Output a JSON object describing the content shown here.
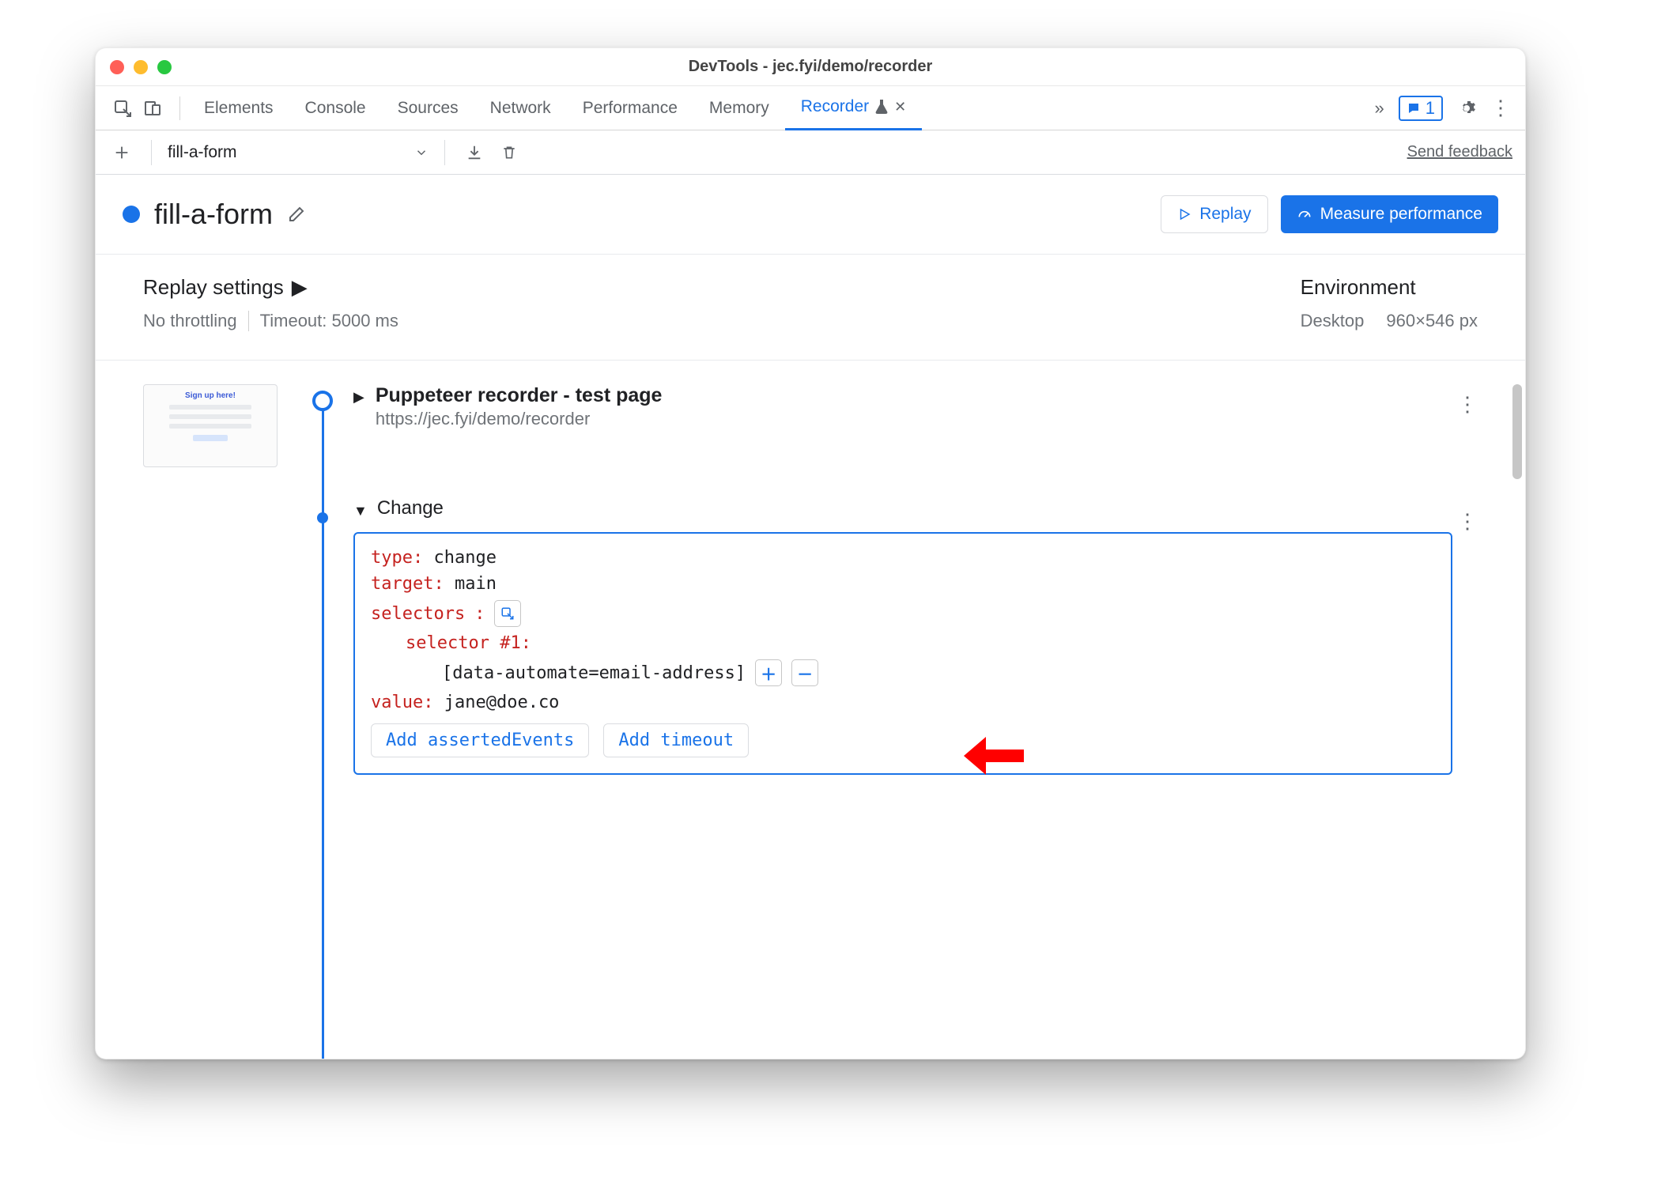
{
  "window": {
    "title": "DevTools - jec.fyi/demo/recorder"
  },
  "tabs": {
    "items": [
      "Elements",
      "Console",
      "Sources",
      "Network",
      "Performance",
      "Memory",
      "Recorder"
    ],
    "active": "Recorder",
    "issues_count": "1"
  },
  "recorder_bar": {
    "recording_name": "fill-a-form",
    "feedback": "Send feedback"
  },
  "title_row": {
    "name": "fill-a-form",
    "replay": "Replay",
    "measure": "Measure performance"
  },
  "replay_settings": {
    "heading": "Replay settings",
    "throttling": "No throttling",
    "timeout": "Timeout: 5000 ms"
  },
  "environment": {
    "heading": "Environment",
    "device": "Desktop",
    "viewport": "960×546 px"
  },
  "steps": {
    "start": {
      "title": "Puppeteer recorder - test page",
      "url": "https://jec.fyi/demo/recorder"
    },
    "change": {
      "title": "Change",
      "type_key": "type",
      "type_val": "change",
      "target_key": "target",
      "target_val": "main",
      "selectors_key": "selectors",
      "selector_label": "selector #1",
      "selector_val": "[data-automate=email-address]",
      "value_key": "value",
      "value_val": "jane@doe.co",
      "add_asserted": "Add assertedEvents",
      "add_timeout": "Add timeout"
    }
  }
}
